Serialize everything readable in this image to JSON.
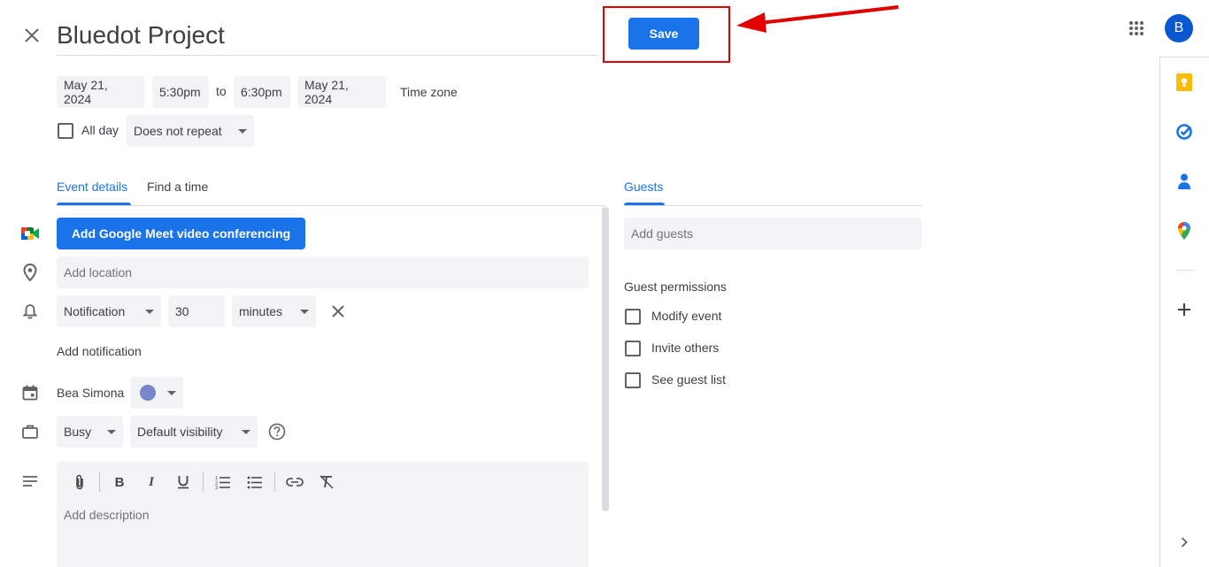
{
  "header": {
    "title": "Bluedot Project",
    "save_label": "Save",
    "avatar_letter": "B"
  },
  "datetime": {
    "start_date": "May 21, 2024",
    "start_time": "5:30pm",
    "to_label": "to",
    "end_time": "6:30pm",
    "end_date": "May 21, 2024",
    "timezone_label": "Time zone",
    "all_day_label": "All day",
    "repeat_value": "Does not repeat"
  },
  "tabs": {
    "event_details": "Event details",
    "find_time": "Find a time",
    "guests": "Guests"
  },
  "details": {
    "meet_button": "Add Google Meet video conferencing",
    "location_placeholder": "Add location",
    "notification_type": "Notification",
    "notification_value": "30",
    "notification_unit": "minutes",
    "add_notification": "Add notification",
    "calendar_owner": "Bea Simona",
    "calendar_color": "#7986cb",
    "availability": "Busy",
    "visibility": "Default visibility",
    "description_placeholder": "Add description"
  },
  "guests": {
    "add_placeholder": "Add guests",
    "permissions_title": "Guest permissions",
    "permissions": [
      "Modify event",
      "Invite others",
      "See guest list"
    ]
  },
  "colors": {
    "accent": "#1a73e8",
    "annotation_red": "#e00000"
  }
}
